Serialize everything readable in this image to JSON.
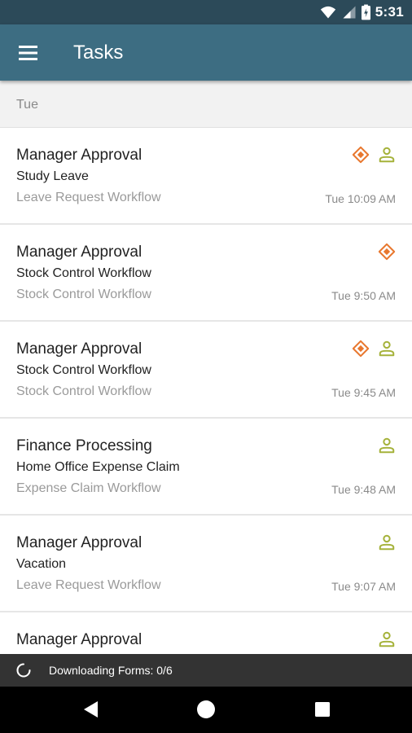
{
  "status_bar": {
    "time": "5:31",
    "icons": [
      "wifi-icon",
      "signal-icon",
      "battery-icon"
    ]
  },
  "app_bar": {
    "title": "Tasks",
    "menu_icon": "hamburger-menu-icon"
  },
  "section": {
    "label": "Tue"
  },
  "tasks": [
    {
      "title": "Manager Approval",
      "subject": "Study Leave",
      "workflow": "Leave Request Workflow",
      "time": "Tue 10:09 AM",
      "flags": [
        "priority",
        "assigned"
      ]
    },
    {
      "title": "Manager Approval",
      "subject": "Stock Control Workflow",
      "workflow": "Stock Control Workflow",
      "time": "Tue 9:50 AM",
      "flags": [
        "priority"
      ]
    },
    {
      "title": "Manager Approval",
      "subject": "Stock Control Workflow",
      "workflow": "Stock Control Workflow",
      "time": "Tue 9:45 AM",
      "flags": [
        "priority",
        "assigned"
      ]
    },
    {
      "title": "Finance Processing",
      "subject": "Home Office Expense Claim",
      "workflow": "Expense Claim Workflow",
      "time": "Tue 9:48 AM",
      "flags": [
        "assigned"
      ]
    },
    {
      "title": "Manager Approval",
      "subject": "Vacation",
      "workflow": "Leave Request Workflow",
      "time": "Tue 9:07 AM",
      "flags": [
        "assigned"
      ]
    },
    {
      "title": "Manager Approval",
      "subject": "",
      "workflow": "",
      "time": "",
      "flags": [
        "assigned"
      ]
    }
  ],
  "icons": {
    "priority": "diamond-priority-icon",
    "assigned": "person-icon"
  },
  "colors": {
    "status_bar": "#2c4a59",
    "app_bar": "#3d6d82",
    "priority_icon": "#e8772e",
    "person_icon": "#a5b23a",
    "download_bar": "#333333"
  },
  "download_bar": {
    "text": "Downloading Forms: 0/6"
  },
  "nav_bar": {
    "buttons": [
      "back-icon",
      "home-icon",
      "recents-icon"
    ]
  }
}
